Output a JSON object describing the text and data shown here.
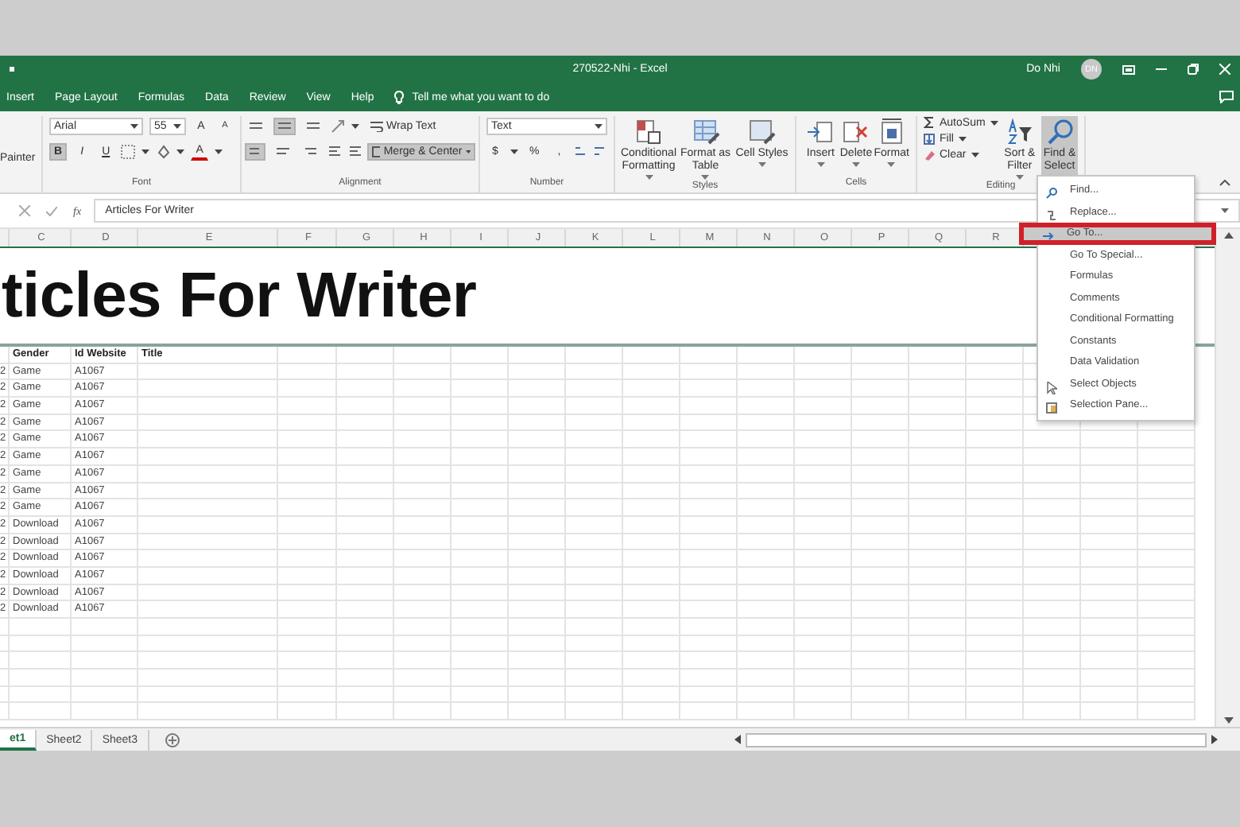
{
  "window": {
    "title": "270522-Nhi - Excel",
    "user": "Do Nhi",
    "avatar": "DN"
  },
  "tabs": [
    {
      "label": "Insert",
      "selected": false
    },
    {
      "label": "Page Layout",
      "selected": false
    },
    {
      "label": "Formulas",
      "selected": false
    },
    {
      "label": "Data",
      "selected": false
    },
    {
      "label": "Review",
      "selected": false
    },
    {
      "label": "View",
      "selected": false
    },
    {
      "label": "Help",
      "selected": false
    }
  ],
  "tell_me": "Tell me what you want to do",
  "ribbon": {
    "clipboard": {
      "painter": "Painter"
    },
    "font": {
      "label": "Font",
      "name": "Arial",
      "size": "55",
      "grow": "A",
      "shrink": "A",
      "color_label": "A",
      "buttons": [
        {
          "label": "B",
          "pressed": true
        },
        {
          "label": "I",
          "pressed": false
        },
        {
          "label": "U",
          "pressed": false
        }
      ]
    },
    "alignment": {
      "label": "Alignment",
      "vertical": [
        {
          "pressed": false
        },
        {
          "pressed": true
        },
        {
          "pressed": false
        }
      ],
      "horizontal": [
        {
          "pressed": true
        },
        {
          "pressed": false
        },
        {
          "pressed": false
        }
      ],
      "wrap": "Wrap Text",
      "merge": {
        "label": "Merge & Center",
        "pressed": true
      }
    },
    "number": {
      "label": "Number",
      "format": "Text",
      "currency": "$",
      "percent": "%",
      "comma": ","
    },
    "styles": {
      "label": "Styles",
      "buttons": [
        "Conditional Formatting",
        "Format as Table",
        "Cell Styles"
      ]
    },
    "cells": {
      "label": "Cells",
      "buttons": [
        "Insert",
        "Delete",
        "Format"
      ]
    },
    "editing": {
      "label": "Editing",
      "autosum": "AutoSum",
      "fill": "Fill",
      "clear": "Clear",
      "sort": "Sort & Filter",
      "find": {
        "label": "Find & Select",
        "selected": true
      }
    }
  },
  "formula_bar": {
    "function_label": "fx",
    "value": "Articles For Writer"
  },
  "sheet": {
    "columns": [
      "C",
      "D",
      "E",
      "F",
      "G",
      "H",
      "I",
      "J",
      "K",
      "L",
      "M",
      "N",
      "O",
      "P",
      "Q",
      "R"
    ],
    "title": "ticles For Writer",
    "header": [
      "Gender",
      "Id Website",
      "Title"
    ],
    "rows": [
      {
        "b": "2",
        "gender": "Game",
        "id": "A1067"
      },
      {
        "b": "2",
        "gender": "Game",
        "id": "A1067"
      },
      {
        "b": "2",
        "gender": "Game",
        "id": "A1067"
      },
      {
        "b": "2",
        "gender": "Game",
        "id": "A1067"
      },
      {
        "b": "2",
        "gender": "Game",
        "id": "A1067"
      },
      {
        "b": "2",
        "gender": "Game",
        "id": "A1067"
      },
      {
        "b": "2",
        "gender": "Game",
        "id": "A1067"
      },
      {
        "b": "2",
        "gender": "Game",
        "id": "A1067"
      },
      {
        "b": "2",
        "gender": "Game",
        "id": "A1067"
      },
      {
        "b": "2",
        "gender": "Download",
        "id": "A1067"
      },
      {
        "b": "2",
        "gender": "Download",
        "id": "A1067"
      },
      {
        "b": "2",
        "gender": "Download",
        "id": "A1067"
      },
      {
        "b": "2",
        "gender": "Download",
        "id": "A1067"
      },
      {
        "b": "2",
        "gender": "Download",
        "id": "A1067"
      },
      {
        "b": "2",
        "gender": "Download",
        "id": "A1067"
      }
    ]
  },
  "sheets": [
    {
      "label": "et1",
      "selected": true
    },
    {
      "label": "Sheet2",
      "selected": false
    },
    {
      "label": "Sheet3",
      "selected": false
    }
  ],
  "menu": {
    "items": [
      {
        "label": "Find...",
        "kind": "find",
        "selected": false
      },
      {
        "label": "Replace...",
        "kind": "replace",
        "selected": false
      },
      {
        "label": "Go To...",
        "kind": "goto",
        "selected": true
      },
      {
        "label": "Go To Special...",
        "kind": "plain",
        "selected": false
      },
      {
        "label": "Formulas",
        "kind": "plain",
        "selected": false
      },
      {
        "label": "Comments",
        "kind": "plain",
        "selected": false
      },
      {
        "label": "Conditional Formatting",
        "kind": "plain",
        "selected": false
      },
      {
        "label": "Constants",
        "kind": "plain",
        "selected": false
      },
      {
        "label": "Data Validation",
        "kind": "plain",
        "selected": false
      },
      {
        "label": "Select Objects",
        "kind": "objects",
        "selected": false
      },
      {
        "label": "Selection Pane...",
        "kind": "pane",
        "selected": false
      }
    ]
  }
}
